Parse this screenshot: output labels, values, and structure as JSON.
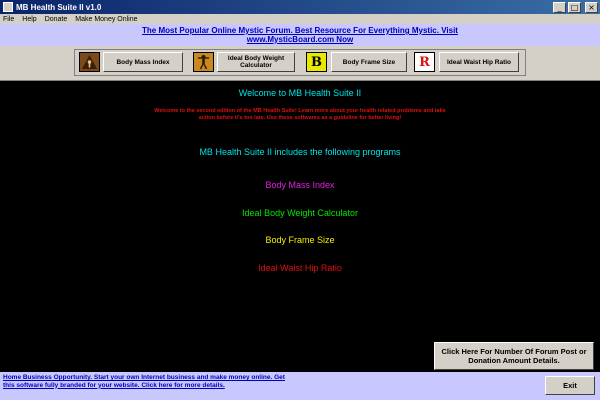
{
  "window": {
    "title": "MB Health Suite II v1.0",
    "controls": {
      "minimize": "_",
      "maximize": "□",
      "close": "×"
    }
  },
  "menu": [
    "File",
    "Help",
    "Donate",
    "Make Money Online"
  ],
  "banner": {
    "line1": "The Most Popular Online Mystic Forum. Best Resource For Everything Mystic. Visit",
    "line2": "www.MysticBoard.com Now"
  },
  "toolbar": {
    "buttons": [
      {
        "label": "Body Mass Index",
        "icon": "triangle-person-icon",
        "icon_color": "#7a4a1a"
      },
      {
        "label": "Ideal Body Weight Calculator",
        "icon": "standing-figure-icon",
        "icon_color": "#c88a20"
      },
      {
        "label": "Body Frame Size",
        "icon": "letter-b-icon",
        "icon_color": "#e8e800",
        "glyph": "B"
      },
      {
        "label": "Ideal Waist Hip Ratio",
        "icon": "letter-r-icon",
        "icon_color": "#e01010",
        "glyph": "R"
      }
    ]
  },
  "main": {
    "heading": "Welcome to MB Health Suite II",
    "intro": "Welcome to the second edition of the MB Health Suite! Learn more about your health related problems and take action before it's too late. Use these softwares as a guideline for better living!",
    "includes": "MB Health Suite II includes the following programs",
    "programs": [
      "Body Mass Index",
      "Ideal Body Weight Calculator",
      "Body Frame Size",
      "Ideal Waist Hip Ratio"
    ],
    "forum_button": "Click Here For Number Of Forum Post or Donation Amount Details."
  },
  "status": {
    "text": "Home Business Opportunity. Start your own Internet business and make money online. Get this software fully branded for your website. Click here for more details.",
    "exit_label": "Exit"
  },
  "colors": {
    "title_bar": "#0a246a",
    "banner_bg": "#c8c8ff",
    "link": "#0000b8",
    "main_bg": "#000000",
    "cyan": "#00e5e5",
    "magenta": "#e020e0",
    "green": "#00e800",
    "yellow": "#f0f000",
    "red": "#e01010"
  }
}
